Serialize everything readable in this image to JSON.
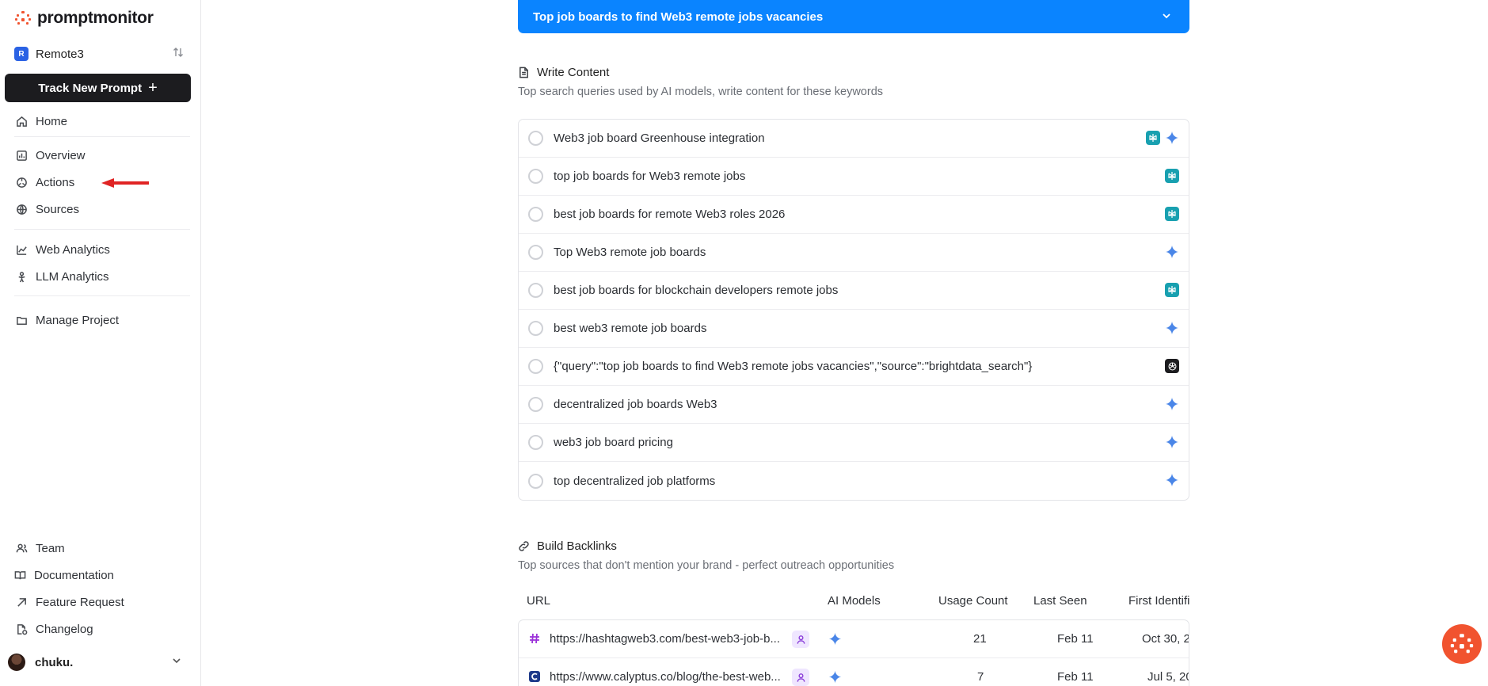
{
  "app": {
    "logo_text": "promptmonitor",
    "brand_color": "#f1532f",
    "accent_color": "#0a84ff"
  },
  "sidebar": {
    "project": {
      "badge": "R",
      "name": "Remote3",
      "switch_icon": "swap-vertical-icon"
    },
    "track_button": {
      "label": "Track New Prompt",
      "icon": "plus-icon"
    },
    "nav": [
      {
        "label": "Home",
        "icon": "home-icon"
      },
      {
        "label": "Overview",
        "icon": "chart-icon"
      },
      {
        "label": "Actions",
        "icon": "actions-icon"
      },
      {
        "label": "Sources",
        "icon": "globe-icon"
      },
      {
        "label": "Web Analytics",
        "icon": "analytics-icon"
      },
      {
        "label": "LLM Analytics",
        "icon": "llm-icon"
      },
      {
        "label": "Manage Project",
        "icon": "folder-icon"
      }
    ],
    "footer_nav": [
      {
        "label": "Team",
        "icon": "team-icon"
      },
      {
        "label": "Documentation",
        "icon": "book-icon"
      },
      {
        "label": "Feature Request",
        "icon": "arrow-up-right-icon"
      },
      {
        "label": "Changelog",
        "icon": "changelog-icon"
      }
    ],
    "user": {
      "name": "chuku."
    },
    "annotation_arrow_color": "#e02424"
  },
  "main": {
    "banner": {
      "title": "Top job boards to find Web3 remote jobs vacancies"
    },
    "write_content": {
      "title": "Write Content",
      "subtitle": "Top search queries used by AI models, write content for these keywords",
      "queries": [
        {
          "text": "Web3 job board Greenhouse integration",
          "icons": [
            "perplexity-icon",
            "gemini-icon"
          ]
        },
        {
          "text": "top job boards for Web3 remote jobs",
          "icons": [
            "perplexity-icon"
          ]
        },
        {
          "text": "best job boards for remote Web3 roles 2026",
          "icons": [
            "perplexity-icon"
          ]
        },
        {
          "text": "Top Web3 remote job boards",
          "icons": [
            "gemini-icon"
          ]
        },
        {
          "text": "best job boards for blockchain developers remote jobs",
          "icons": [
            "perplexity-icon"
          ]
        },
        {
          "text": "best web3 remote job boards",
          "icons": [
            "gemini-icon"
          ]
        },
        {
          "text": "{\"query\":\"top job boards to find Web3 remote jobs vacancies\",\"source\":\"brightdata_search\"}",
          "icons": [
            "openai-icon"
          ]
        },
        {
          "text": "decentralized job boards Web3",
          "icons": [
            "gemini-icon"
          ]
        },
        {
          "text": "web3 job board pricing",
          "icons": [
            "gemini-icon"
          ]
        },
        {
          "text": "top decentralized job platforms",
          "icons": [
            "gemini-icon"
          ]
        }
      ]
    },
    "build_backlinks": {
      "title": "Build Backlinks",
      "subtitle": "Top sources that don't mention your brand - perfect outreach opportunities",
      "columns": [
        "URL",
        "AI Models",
        "Usage Count",
        "Last Seen",
        "First Identifi"
      ],
      "rows": [
        {
          "url": "https://hashtagweb3.com/best-web3-job-b...",
          "favicon": "hashtag-icon",
          "usage_count": "21",
          "last_seen": "Feb 11",
          "first_identified": "Oct 30, 2"
        },
        {
          "url": "https://www.calyptus.co/blog/the-best-web...",
          "favicon": "calyptus-icon",
          "usage_count": "7",
          "last_seen": "Feb 11",
          "first_identified": "Jul 5, 20"
        }
      ]
    }
  }
}
